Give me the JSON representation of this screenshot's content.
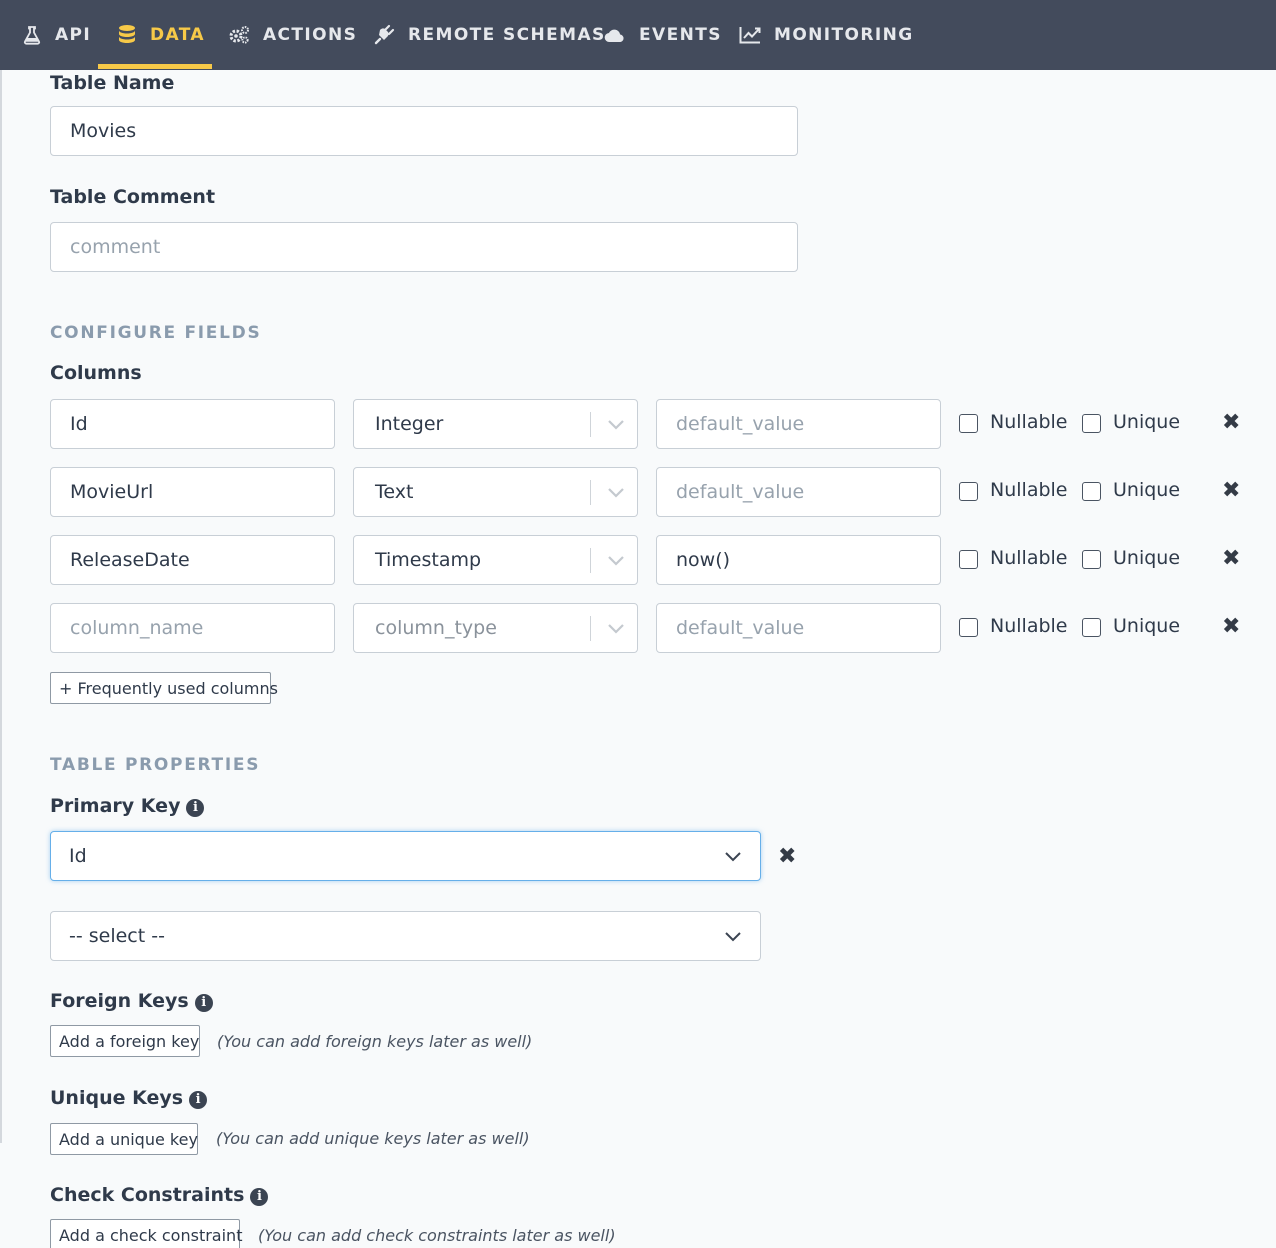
{
  "nav": {
    "items": [
      {
        "label": "API",
        "icon": "flask-icon"
      },
      {
        "label": "DATA",
        "icon": "database-icon"
      },
      {
        "label": "ACTIONS",
        "icon": "gears-icon"
      },
      {
        "label": "REMOTE SCHEMAS",
        "icon": "plug-icon"
      },
      {
        "label": "EVENTS",
        "icon": "cloud-icon"
      },
      {
        "label": "MONITORING",
        "icon": "line-chart-icon"
      }
    ],
    "active": "DATA",
    "accent": "#f7c948",
    "background": "#434b5c"
  },
  "form": {
    "table_name_label": "Table Name",
    "table_name_value": "Movies",
    "table_comment_label": "Table Comment",
    "table_comment_placeholder": "comment",
    "configure_fields_heading": "CONFIGURE FIELDS",
    "columns_label": "Columns",
    "columns": [
      {
        "name": "Id",
        "type": "Integer",
        "default": "",
        "default_placeholder": "default_value",
        "nullable": false,
        "unique": false
      },
      {
        "name": "MovieUrl",
        "type": "Text",
        "default": "",
        "default_placeholder": "default_value",
        "nullable": false,
        "unique": false
      },
      {
        "name": "ReleaseDate",
        "type": "Timestamp",
        "default": "now()",
        "default_placeholder": "default_value",
        "nullable": false,
        "unique": false
      },
      {
        "name": "",
        "name_placeholder": "column_name",
        "type": "",
        "type_placeholder": "column_type",
        "default": "",
        "default_placeholder": "default_value",
        "nullable": false,
        "unique": false
      }
    ],
    "nullable_label": "Nullable",
    "unique_label": "Unique",
    "remove_glyph": "✖",
    "frequent_columns_button": "+ Frequently used columns",
    "table_properties_heading": "TABLE PROPERTIES",
    "primary_key_label": "Primary Key",
    "primary_key_selected": "Id",
    "primary_key_next_placeholder": "-- select --",
    "foreign_keys_label": "Foreign Keys",
    "add_foreign_key_button": "Add a foreign key",
    "foreign_keys_hint": "(You can add foreign keys later as well)",
    "unique_keys_label": "Unique Keys",
    "add_unique_key_button": "Add a unique key",
    "unique_keys_hint": "(You can add unique keys later as well)",
    "check_constraints_label": "Check Constraints",
    "add_check_constraint_button": "Add a check constraint",
    "check_constraints_hint": "(You can add check constraints later as well)"
  }
}
